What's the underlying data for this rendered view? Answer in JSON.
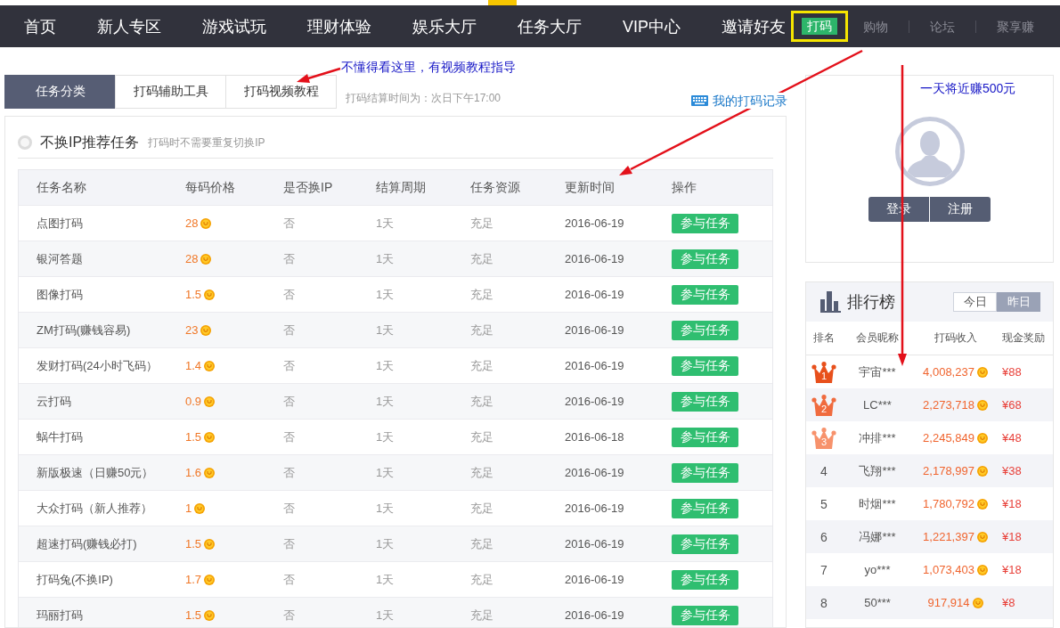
{
  "nav": {
    "items": [
      "首页",
      "新人专区",
      "游戏试玩",
      "理财体验",
      "娱乐大厅",
      "任务大厅",
      "VIP中心",
      "邀请好友"
    ],
    "links": [
      {
        "label": "打码",
        "kind": "button",
        "highlighted": true
      },
      {
        "label": "购物",
        "kind": "link",
        "highlighted": false
      },
      {
        "label": "论坛",
        "kind": "link",
        "highlighted": false
      },
      {
        "label": "聚享赚",
        "kind": "link",
        "highlighted": false
      }
    ]
  },
  "note_row": {
    "annotation": "不懂得看这里，有视频教程指导"
  },
  "tabs": [
    {
      "label": "任务分类",
      "selected": true
    },
    {
      "label": "打码辅助工具",
      "selected": false
    },
    {
      "label": "打码视频教程",
      "selected": false
    }
  ],
  "settlement_note": "打码结算时间为：次日下午17:00",
  "records_link": "我的打码记录",
  "section": {
    "title": "不换IP推荐任务",
    "hint": "打码时不需要重复切换IP"
  },
  "table": {
    "columns": [
      "任务名称",
      "每码价格",
      "是否换IP",
      "结算周期",
      "任务资源",
      "更新时间",
      "操作"
    ],
    "rows": [
      {
        "name": "点图打码",
        "price": "28",
        "change_ip": "否",
        "cycle": "1天",
        "resource": "充足",
        "updated": "2016-06-19",
        "action": "参与任务"
      },
      {
        "name": "银河答题",
        "price": "28",
        "change_ip": "否",
        "cycle": "1天",
        "resource": "充足",
        "updated": "2016-06-19",
        "action": "参与任务"
      },
      {
        "name": "图像打码",
        "price": "1.5",
        "change_ip": "否",
        "cycle": "1天",
        "resource": "充足",
        "updated": "2016-06-19",
        "action": "参与任务"
      },
      {
        "name": "ZM打码(赚钱容易)",
        "price": "23",
        "change_ip": "否",
        "cycle": "1天",
        "resource": "充足",
        "updated": "2016-06-19",
        "action": "参与任务"
      },
      {
        "name": "发财打码(24小时飞码）",
        "price": "1.4",
        "change_ip": "否",
        "cycle": "1天",
        "resource": "充足",
        "updated": "2016-06-19",
        "action": "参与任务"
      },
      {
        "name": "云打码",
        "price": "0.9",
        "change_ip": "否",
        "cycle": "1天",
        "resource": "充足",
        "updated": "2016-06-19",
        "action": "参与任务"
      },
      {
        "name": "蜗牛打码",
        "price": "1.5",
        "change_ip": "否",
        "cycle": "1天",
        "resource": "充足",
        "updated": "2016-06-18",
        "action": "参与任务"
      },
      {
        "name": "新版极速（日赚50元）",
        "price": "1.6",
        "change_ip": "否",
        "cycle": "1天",
        "resource": "充足",
        "updated": "2016-06-19",
        "action": "参与任务"
      },
      {
        "name": "大众打码（新人推荐）",
        "price": "1",
        "change_ip": "否",
        "cycle": "1天",
        "resource": "充足",
        "updated": "2016-06-19",
        "action": "参与任务"
      },
      {
        "name": "超速打码(赚钱必打)",
        "price": "1.5",
        "change_ip": "否",
        "cycle": "1天",
        "resource": "充足",
        "updated": "2016-06-19",
        "action": "参与任务"
      },
      {
        "name": "打码兔(不换IP)",
        "price": "1.7",
        "change_ip": "否",
        "cycle": "1天",
        "resource": "充足",
        "updated": "2016-06-19",
        "action": "参与任务"
      },
      {
        "name": "玛丽打码",
        "price": "1.5",
        "change_ip": "否",
        "cycle": "1天",
        "resource": "充足",
        "updated": "2016-06-19",
        "action": "参与任务"
      }
    ]
  },
  "user_card": {
    "annotation": "一天将近赚500元",
    "buttons": [
      "登录",
      "注册"
    ]
  },
  "ranking": {
    "title": "排行榜",
    "periods": [
      {
        "label": "今日",
        "selected": false
      },
      {
        "label": "昨日",
        "selected": true
      }
    ],
    "columns": [
      "排名",
      "会员昵称",
      "打码收入",
      "现金奖励"
    ],
    "rows": [
      {
        "kind": "crown",
        "rank": "1",
        "color": "#e8501c",
        "name": "宇宙***",
        "income": "4,008,237",
        "reward": "¥88"
      },
      {
        "kind": "crown",
        "rank": "2",
        "color": "#f06b3e",
        "name": "LC***",
        "income": "2,273,718",
        "reward": "¥68"
      },
      {
        "kind": "crown",
        "rank": "3",
        "color": "#f7926c",
        "name": "冲排***",
        "income": "2,245,849",
        "reward": "¥48"
      },
      {
        "kind": "plain",
        "rank": "4",
        "name": "飞翔***",
        "income": "2,178,997",
        "reward": "¥38"
      },
      {
        "kind": "plain",
        "rank": "5",
        "name": "时烟***",
        "income": "1,780,792",
        "reward": "¥18"
      },
      {
        "kind": "plain",
        "rank": "6",
        "name": "冯娜***",
        "income": "1,221,397",
        "reward": "¥18"
      },
      {
        "kind": "plain",
        "rank": "7",
        "name": "yo***",
        "income": "1,073,403",
        "reward": "¥18"
      },
      {
        "kind": "plain",
        "rank": "8",
        "name": "50***",
        "income": "917,914",
        "reward": "¥8"
      }
    ]
  }
}
